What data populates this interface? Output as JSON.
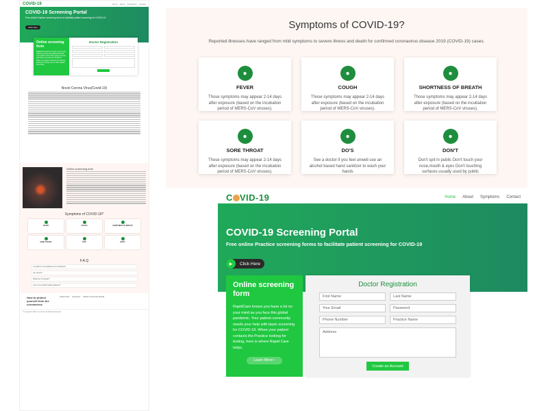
{
  "left": {
    "logo": "COVID-19",
    "nav": [
      "Home",
      "About",
      "Symptoms",
      "Contact"
    ],
    "hero_title": "COVID-19 Screening Portal",
    "hero_sub": "Free online Practice screening forms to facilitate patient screening for COVID-19",
    "hero_btn": "Click Here",
    "card_title": "Online screening form",
    "reg_title": "Doctor Registration",
    "create_btn": "Create an Account",
    "section1": "Novel Corona Virus(Covid-19)",
    "section2": "Online screening form",
    "section3": "Symptoms of COVID-19?",
    "cards": [
      "FEVER",
      "COUGH",
      "SHORTNESS OF BREATH",
      "SORE THROAT",
      "DO'S",
      "DON'T"
    ],
    "faq_title": "F.A.Q",
    "faqs": [
      "Is problem? uncertainties are completely?",
      "Any issues?",
      "What are Timescale?",
      "Can a new public health guidance?"
    ],
    "footer_head": "How to protect yourself from the coronavirus",
    "footer_cols": [
      "Useful Links",
      "Symptoms",
      "What's Community Spread"
    ],
    "copyright": "© Copyright 2020. Covid-19. All Rights Reserved"
  },
  "symptoms": {
    "title": "Symptoms of COVID-19?",
    "subtitle": "Reported illnesses have ranged from mild symptoms to severe illness and death for confirmed coronavirus disease 2019 (COVID-19) cases.",
    "cards": [
      {
        "title": "FEVER",
        "text": "Those symptoms may appear 2-14 days after exposure (based on the incubation period of MERS-CoV viruses)."
      },
      {
        "title": "COUGH",
        "text": "Those symptoms may appear 2-14 days after exposure (based on the incubation period of MERS-CoV viruses)."
      },
      {
        "title": "SHORTNESS OF BREATH",
        "text": "Those symptoms may appear 2-14 days after exposure (based on the incubation period of MERS-CoV viruses)."
      },
      {
        "title": "SORE THROAT",
        "text": "Those symptoms may appear 2-14 days after exposure (based on the incubation period of MERS-CoV viruses)."
      },
      {
        "title": "DO'S",
        "text": "See a doctor if you feel unwell use an alcohol based hand sanitizer to wash your hands"
      },
      {
        "title": "DON'T",
        "text": "Don't spit in public Don't touch your nose,mouth & eyes Don't touching surfaces usually usod by public"
      }
    ]
  },
  "main": {
    "brand": "C?VID-19",
    "nav": {
      "home": "Home",
      "about": "About",
      "symptoms": "Symptoms",
      "contact": "Contact"
    },
    "hero_title": "COVID-19 Screening Portal",
    "hero_sub": "Free online Practice screening forms to facilitate patient screening for COVID-19",
    "click_here": "Click Here",
    "card_title": "Online screening form",
    "card_text": "RapidCare knows you have a lot on your mind as you face this global pandemic. Your patient community needs your help with basic screening for COVID-19. When your patient contacts the Practice looking for testing, here is where Rapid Care helps.",
    "learn_more": "Learn More ›",
    "reg_title": "Doctor Registration",
    "fields": {
      "first": "First Name",
      "last": "Last Name",
      "email": "Your Email",
      "password": "Password",
      "phone": "Phone Number",
      "practice": "Practice Name",
      "address": "Address"
    },
    "create": "Create an Account"
  },
  "colors": {
    "green": "#1e8e3e",
    "bright_green": "#1fc840",
    "panel_bg": "#fdf6f3"
  },
  "icons": [
    "user-icon",
    "play-icon",
    "chevron-right-icon",
    "virus-image"
  ]
}
